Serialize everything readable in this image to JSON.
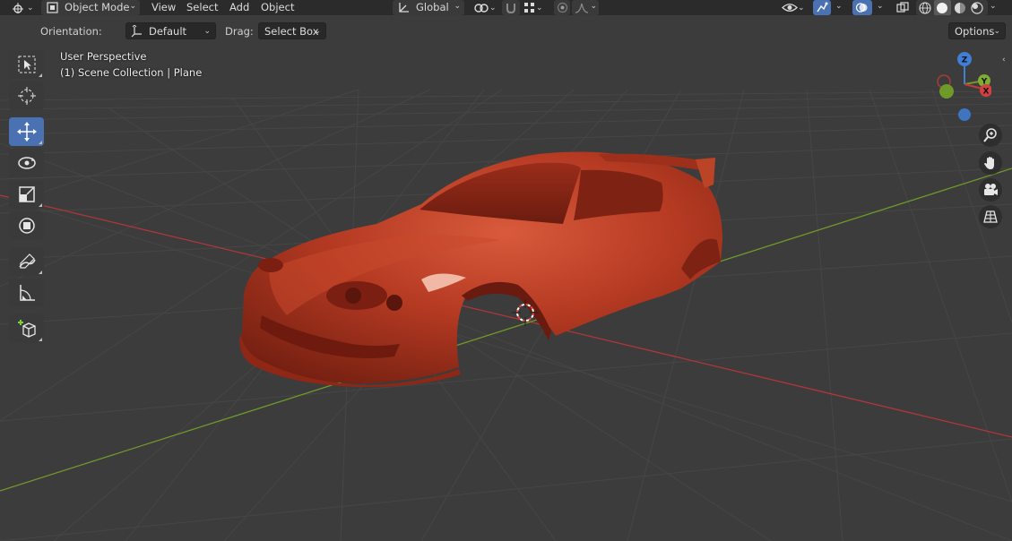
{
  "header": {
    "mode_label": "Object Mode",
    "menus": [
      "View",
      "Select",
      "Add",
      "Object"
    ],
    "transform_orientation": "Global",
    "icons": [
      "editor-type-icon",
      "mode-icon",
      "orientation-icon",
      "pivot-icon",
      "snap-icon",
      "snap-increment-icon",
      "proportional-edit-icon",
      "falloff-icon",
      "visibility-icon",
      "gizmo-icon",
      "overlay-icon",
      "xray-icon",
      "shading-wireframe-icon",
      "shading-solid-icon",
      "shading-material-icon",
      "shading-rendered-icon"
    ]
  },
  "tool_settings": {
    "orientation_label": "Orientation:",
    "orientation_value": "Default",
    "drag_label": "Drag:",
    "drag_value": "Select Box",
    "options_label": "Options"
  },
  "toolbar": {
    "tools": [
      "select-box-tool",
      "cursor-tool",
      "move-tool",
      "rotate-tool",
      "scale-tool",
      "transform-tool",
      "annotate-tool",
      "measure-tool",
      "add-cube-tool"
    ],
    "active_tool": "move-tool"
  },
  "viewport": {
    "view_name": "User Perspective",
    "collection_info": "(1) Scene Collection | Plane",
    "object_color": "#b53a22"
  },
  "gizmo": {
    "x_label": "X",
    "y_label": "Y",
    "z_label": "Z"
  },
  "nav_buttons": [
    "zoom-icon",
    "hand-icon",
    "camera-icon",
    "grid-icon"
  ],
  "colors": {
    "accent": "#4a72b3",
    "axis_x": "#c43a3a",
    "axis_y": "#6f9a2a",
    "axis_z": "#3f7fd6",
    "background": "#3c3c3c"
  }
}
